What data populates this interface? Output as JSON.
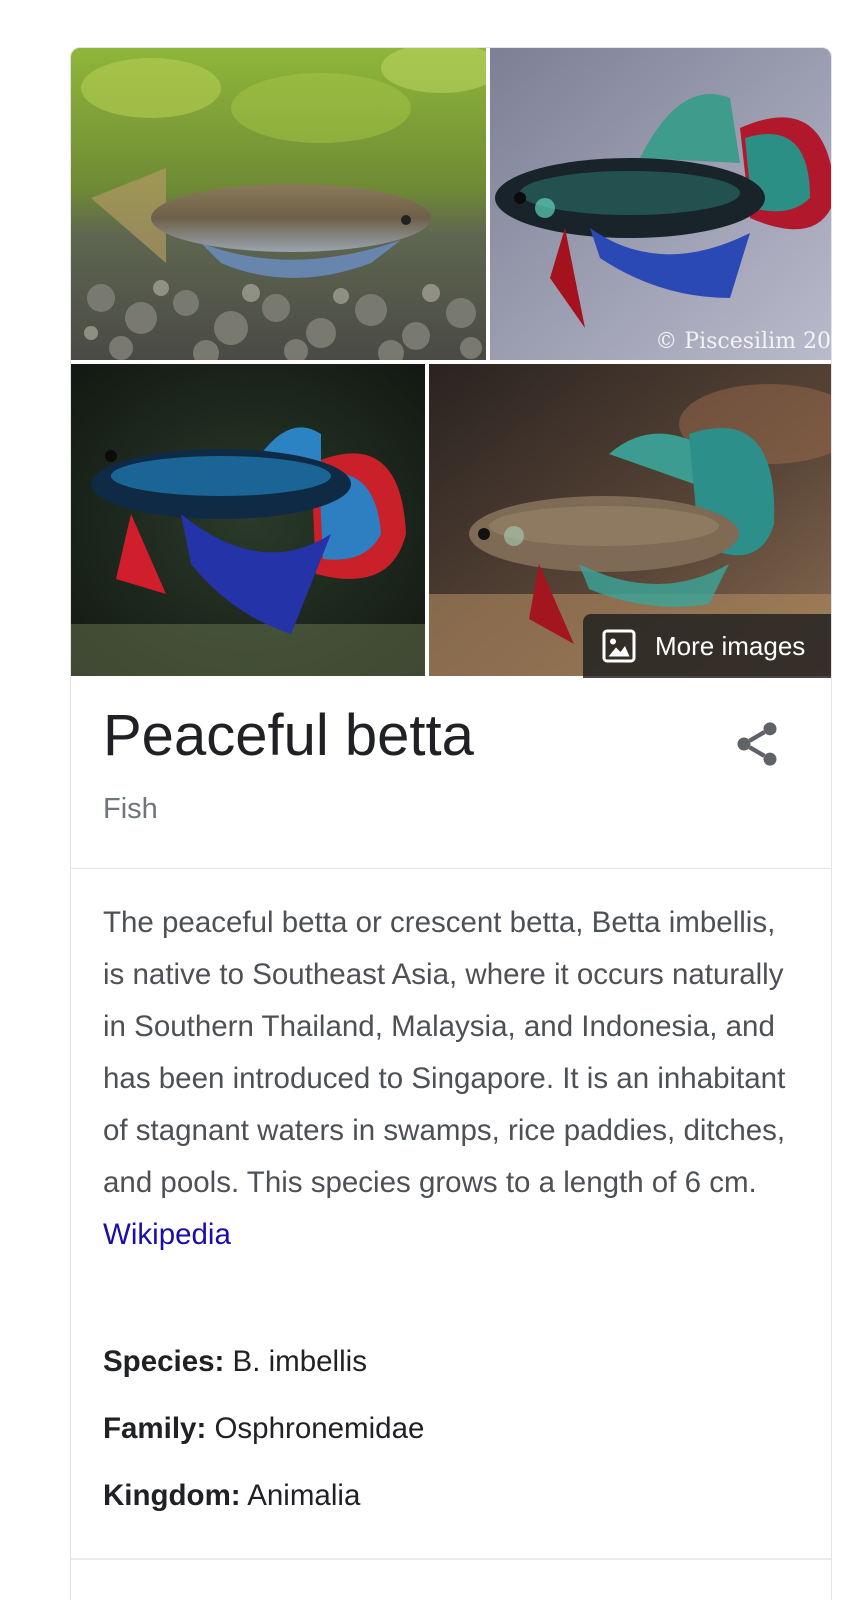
{
  "images": {
    "watermark": "© Piscesilim 20",
    "more_images_label": "More images"
  },
  "entity": {
    "title": "Peaceful betta",
    "subtitle": "Fish"
  },
  "description": {
    "text": "The peaceful betta or crescent betta, Betta imbellis, is native to Southeast Asia, where it occurs naturally in Southern Thailand, Malaysia, and Indonesia, and has been introduced to Singapore. It is an inhabitant of stagnant waters in swamps, rice paddies, ditches, and pools. This species grows to a length of 6 cm.",
    "source_link": "Wikipedia"
  },
  "facts": {
    "species": {
      "label": "Species:",
      "value": "B. imbellis"
    },
    "family": {
      "label": "Family:",
      "value": "Osphronemidae"
    },
    "kingdom": {
      "label": "Kingdom:",
      "value": "Animalia"
    }
  },
  "colors": {
    "title": "#202124",
    "subtitle": "#70757a",
    "body_text": "#4d5156",
    "link": "#1a0dab"
  },
  "icons": {
    "more_images": "image-icon",
    "share": "share-icon"
  }
}
